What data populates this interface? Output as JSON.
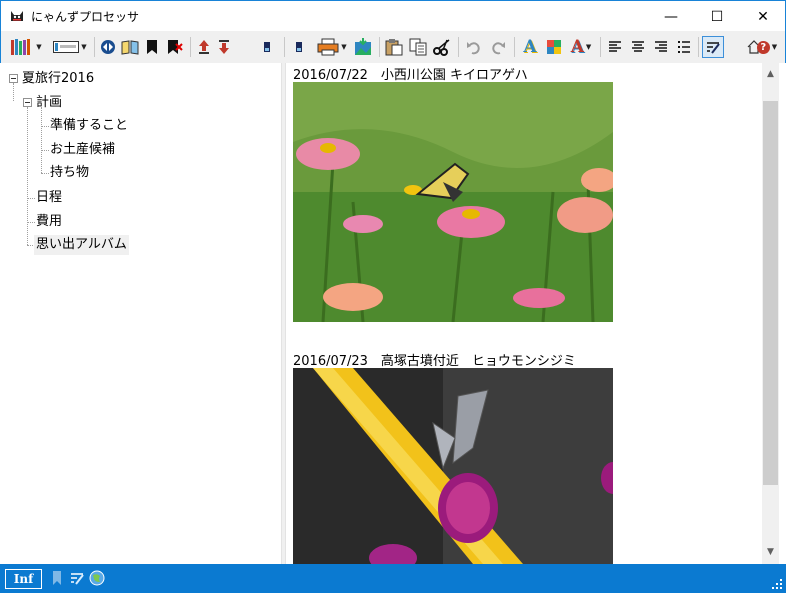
{
  "window": {
    "title": "にゃんずプロセッサ",
    "minimize_glyph": "—",
    "maximize_glyph": "☐",
    "close_glyph": "✕"
  },
  "toolbar": {
    "icons": [
      "bookshelf-icon",
      "tree-layout-icon",
      "navigate-icon",
      "open-book-icon",
      "bookmark-icon",
      "bookmark-delete-icon",
      "move-up-icon",
      "move-down-icon",
      "node-icon",
      "node-icon",
      "print-icon",
      "insert-image-icon",
      "paste-icon",
      "copy-icon",
      "cut-icon",
      "undo-icon",
      "redo-icon",
      "font-icon",
      "color-icon",
      "text-color-icon",
      "align-left-icon",
      "align-center-icon",
      "align-right-icon",
      "list-icon",
      "edit-mode-icon",
      "help-icon"
    ],
    "font_label": "A",
    "help_label": "?"
  },
  "tree": {
    "root": "夏旅行2016",
    "plan": "計画",
    "plan_children": [
      "準備すること",
      "お土産候補",
      "持ち物"
    ],
    "schedule": "日程",
    "cost": "費用",
    "album": "思い出アルバム"
  },
  "content": {
    "entries": [
      {
        "caption": "2016/07/22　小西川公園 キイロアゲハ"
      },
      {
        "caption": "2016/07/23　高塚古墳付近　ヒョウモンシジミ"
      }
    ]
  },
  "statusbar": {
    "mode": "Inf"
  },
  "colors": {
    "accent": "#0b7ad1",
    "window_border": "#1883d7"
  }
}
